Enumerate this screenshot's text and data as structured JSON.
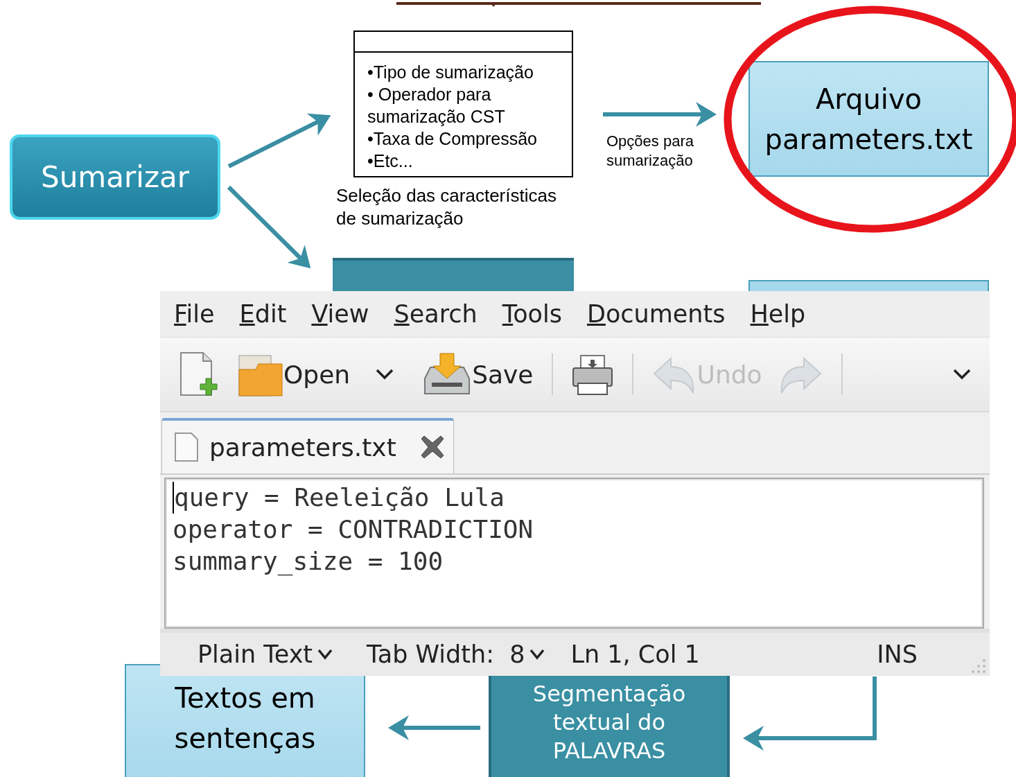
{
  "diagram": {
    "sumarizar": "Sumarizar",
    "features_box": {
      "lines": [
        "•Tipo de sumarização",
        "• Operador para",
        "sumarização CST",
        "•Taxa de Compressão",
        "•Etc..."
      ]
    },
    "features_caption": "Seleção das características de sumarização",
    "options_label": "Opções para sumarização",
    "file_node": "Arquivo parameters.txt",
    "sentences_node": "Textos em sentenças",
    "segmentation_node": "Segmentação textual do PALAVRAS"
  },
  "editor": {
    "menu": [
      "File",
      "Edit",
      "View",
      "Search",
      "Tools",
      "Documents",
      "Help"
    ],
    "toolbar": [
      {
        "kind": "new",
        "disabled": false
      },
      {
        "kind": "open",
        "label": "Open",
        "disabled": false
      },
      {
        "kind": "dropdown",
        "disabled": false
      },
      {
        "kind": "save",
        "label": "Save",
        "disabled": false
      },
      {
        "kind": "separator"
      },
      {
        "kind": "print",
        "disabled": false
      },
      {
        "kind": "separator"
      },
      {
        "kind": "undo",
        "label": "Undo",
        "disabled": true
      },
      {
        "kind": "redo",
        "disabled": true
      },
      {
        "kind": "separator"
      },
      {
        "kind": "overflow",
        "disabled": false
      }
    ],
    "tab": {
      "label": "parameters.txt"
    },
    "lines": [
      "query = Reeleição Lula",
      "operator = CONTRADICTION",
      "summary_size = 100"
    ],
    "status_bar": [
      {
        "kind": "dropdown",
        "text": "Plain Text"
      },
      {
        "kind": "dropdown",
        "text": "Tab Width:  8"
      },
      {
        "kind": "text",
        "text": "Ln 1, Col 1"
      },
      {
        "kind": "text",
        "text": "INS"
      }
    ]
  }
}
